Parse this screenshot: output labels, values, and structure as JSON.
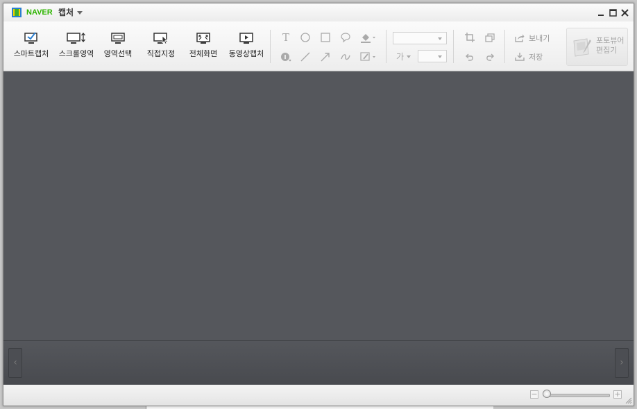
{
  "window": {
    "brand": "NAVER",
    "title": "캡처"
  },
  "capture_buttons": [
    {
      "label": "스마트캡처",
      "icon": "smart-capture-icon"
    },
    {
      "label": "스크롤영역",
      "icon": "scroll-capture-icon"
    },
    {
      "label": "영역선택",
      "icon": "area-select-icon"
    },
    {
      "label": "직접지정",
      "icon": "manual-select-icon"
    },
    {
      "label": "전체화면",
      "icon": "fullscreen-icon"
    },
    {
      "label": "동영상캡처",
      "icon": "video-capture-icon"
    }
  ],
  "draw_tools": {
    "text": "T",
    "font_sample": "가"
  },
  "actions": {
    "send": "보내기",
    "save": "저장",
    "editor": "포토뷰어 편집기"
  },
  "colors": {
    "brand": "#2db400",
    "canvas": "#55575c",
    "toolbar": "#f2f2f2"
  }
}
